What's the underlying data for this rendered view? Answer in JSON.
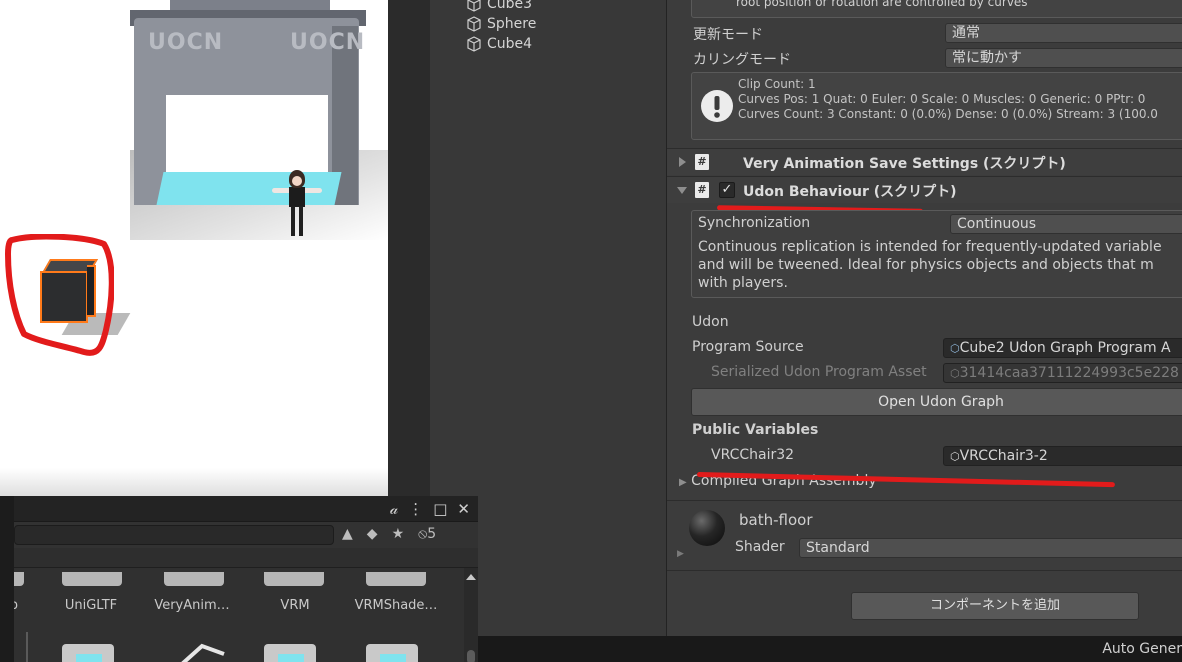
{
  "scene": {
    "gate_logo_left": "UOCN",
    "gate_logo_right": "UOCN"
  },
  "hierarchy": {
    "items": [
      {
        "label": "Cube3"
      },
      {
        "label": "Sphere"
      },
      {
        "label": "Cube4"
      }
    ]
  },
  "animator": {
    "header_note": "root position or rotation are controlled by curves",
    "update_mode_label": "更新モード",
    "update_mode_value": "通常",
    "culling_mode_label": "カリングモード",
    "culling_mode_value": "常に動かす",
    "clip_info": [
      "Clip Count: 1",
      "Curves Pos: 1 Quat: 0 Euler: 0 Scale: 0 Muscles: 0 Generic: 0 PPtr: 0",
      "Curves Count: 3 Constant: 0 (0.0%) Dense: 0 (0.0%) Stream: 3 (100.0"
    ]
  },
  "components": {
    "very_animation_title": "Very Animation Save Settings (スクリプト)",
    "udon_behaviour_title": "Udon Behaviour (スクリプト)"
  },
  "udon": {
    "sync_label": "Synchronization",
    "sync_value": "Continuous",
    "sync_help": [
      "Continuous replication is intended for frequently-updated variable",
      "and will be tweened. Ideal for physics objects and objects that m",
      "with players."
    ],
    "section_label": "Udon",
    "program_source_label": "Program Source",
    "program_source_value": "Cube2 Udon Graph Program A",
    "serialized_label": "Serialized Udon Program Asset",
    "serialized_value": "31414caa37111224993c5e228",
    "open_graph_button": "Open Udon Graph",
    "public_vars_label": "Public Variables",
    "var_name": "VRCChair32",
    "var_value": "VRCChair3-2",
    "compiled_label": "Compiled Graph Assembly"
  },
  "material": {
    "name": "bath-floor",
    "shader_label": "Shader",
    "shader_value": "Standard"
  },
  "add_component_button": "コンポーネントを追加",
  "project": {
    "hidden_count": "5",
    "folders": [
      "rp",
      "UniGLTF",
      "VeryAnim…",
      "VRM",
      "VRMShade…"
    ]
  },
  "status": {
    "text": "Auto Gener"
  },
  "colors": {
    "annotation_red": "#e21b1b",
    "selection_orange": "#ff7a1a",
    "water_cyan": "#7fe3ee"
  }
}
